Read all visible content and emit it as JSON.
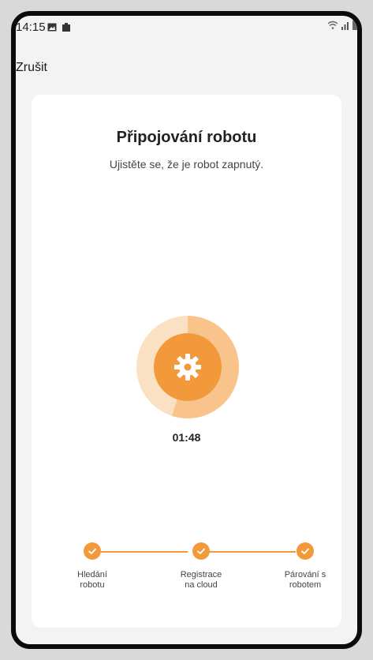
{
  "status_bar": {
    "time": "14:15",
    "left_icons": [
      "image-icon",
      "battery-icon"
    ],
    "right_icons": [
      "wifi-icon",
      "signal-icon",
      "battery-icon"
    ]
  },
  "header": {
    "cancel_label": "Zrušit"
  },
  "card": {
    "title": "Připojování robotu",
    "subtitle": "Ujistěte se, že je robot zapnutý.",
    "center_icon": "gear-icon",
    "countdown": "01:48",
    "progress_fraction": 0.55
  },
  "steps": [
    {
      "label_line1": "Hledání",
      "label_line2": "robotu",
      "done": true
    },
    {
      "label_line1": "Registrace",
      "label_line2": "na cloud",
      "done": true
    },
    {
      "label_line1": "Párování s",
      "label_line2": "robotem",
      "done": true
    }
  ],
  "colors": {
    "accent": "#F29A3B",
    "accent_light": "#F8C48B",
    "accent_pale": "#FBE1C4",
    "card_bg": "#FFFFFF",
    "screen_bg": "#F3F3F3"
  }
}
